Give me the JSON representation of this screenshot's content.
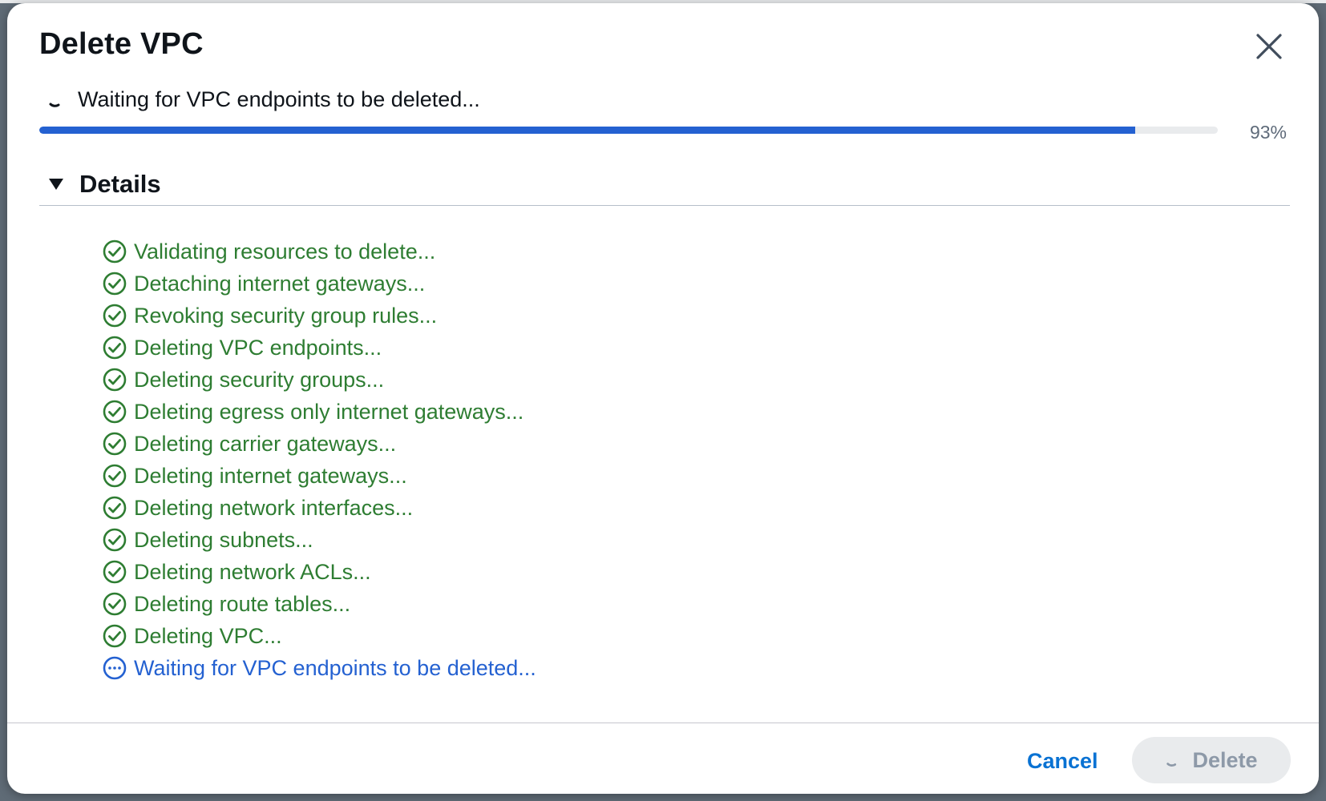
{
  "dialog": {
    "title": "Delete VPC",
    "close_icon": "close-icon"
  },
  "status": {
    "icon": "spinner-icon",
    "text": "Waiting for VPC endpoints to be deleted...",
    "progress_percent": 93,
    "progress_label": "93%",
    "accent_color": "#2461d1"
  },
  "details": {
    "label": "Details",
    "expanded": true,
    "steps": [
      {
        "label": "Validating resources to delete...",
        "state": "done"
      },
      {
        "label": "Detaching internet gateways...",
        "state": "done"
      },
      {
        "label": "Revoking security group rules...",
        "state": "done"
      },
      {
        "label": "Deleting VPC endpoints...",
        "state": "done"
      },
      {
        "label": "Deleting security groups...",
        "state": "done"
      },
      {
        "label": "Deleting egress only internet gateways...",
        "state": "done"
      },
      {
        "label": "Deleting carrier gateways...",
        "state": "done"
      },
      {
        "label": "Deleting internet gateways...",
        "state": "done"
      },
      {
        "label": "Deleting network interfaces...",
        "state": "done"
      },
      {
        "label": "Deleting subnets...",
        "state": "done"
      },
      {
        "label": "Deleting network ACLs...",
        "state": "done"
      },
      {
        "label": "Deleting route tables...",
        "state": "done"
      },
      {
        "label": "Deleting VPC...",
        "state": "done"
      },
      {
        "label": "Waiting for VPC endpoints to be deleted...",
        "state": "in-progress"
      }
    ],
    "done_color": "#2e7d32",
    "pending_color": "#2461d1"
  },
  "footer": {
    "cancel_label": "Cancel",
    "delete_label": "Delete",
    "delete_disabled": true
  }
}
